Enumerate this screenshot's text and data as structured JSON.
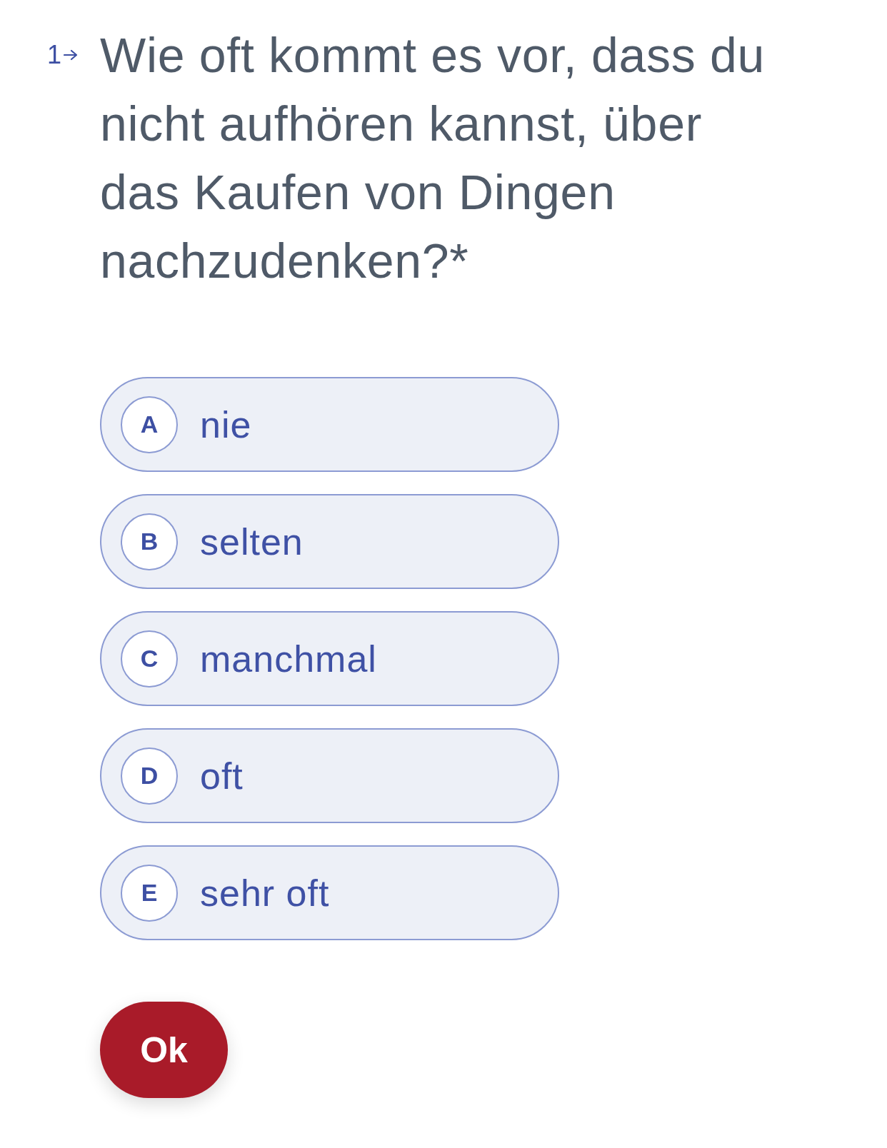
{
  "question": {
    "number": "1",
    "text": "Wie oft kommt es vor, dass du nicht aufhören kannst, über das Kaufen von Dingen nachzudenken?*"
  },
  "options": [
    {
      "key": "A",
      "label": "nie",
      "selected": false
    },
    {
      "key": "B",
      "label": "selten",
      "selected": false
    },
    {
      "key": "C",
      "label": "manchmal",
      "selected": false
    },
    {
      "key": "D",
      "label": "oft",
      "selected": false
    },
    {
      "key": "E",
      "label": "sehr oft",
      "selected": false
    }
  ],
  "submit_button": {
    "label": "Ok"
  }
}
